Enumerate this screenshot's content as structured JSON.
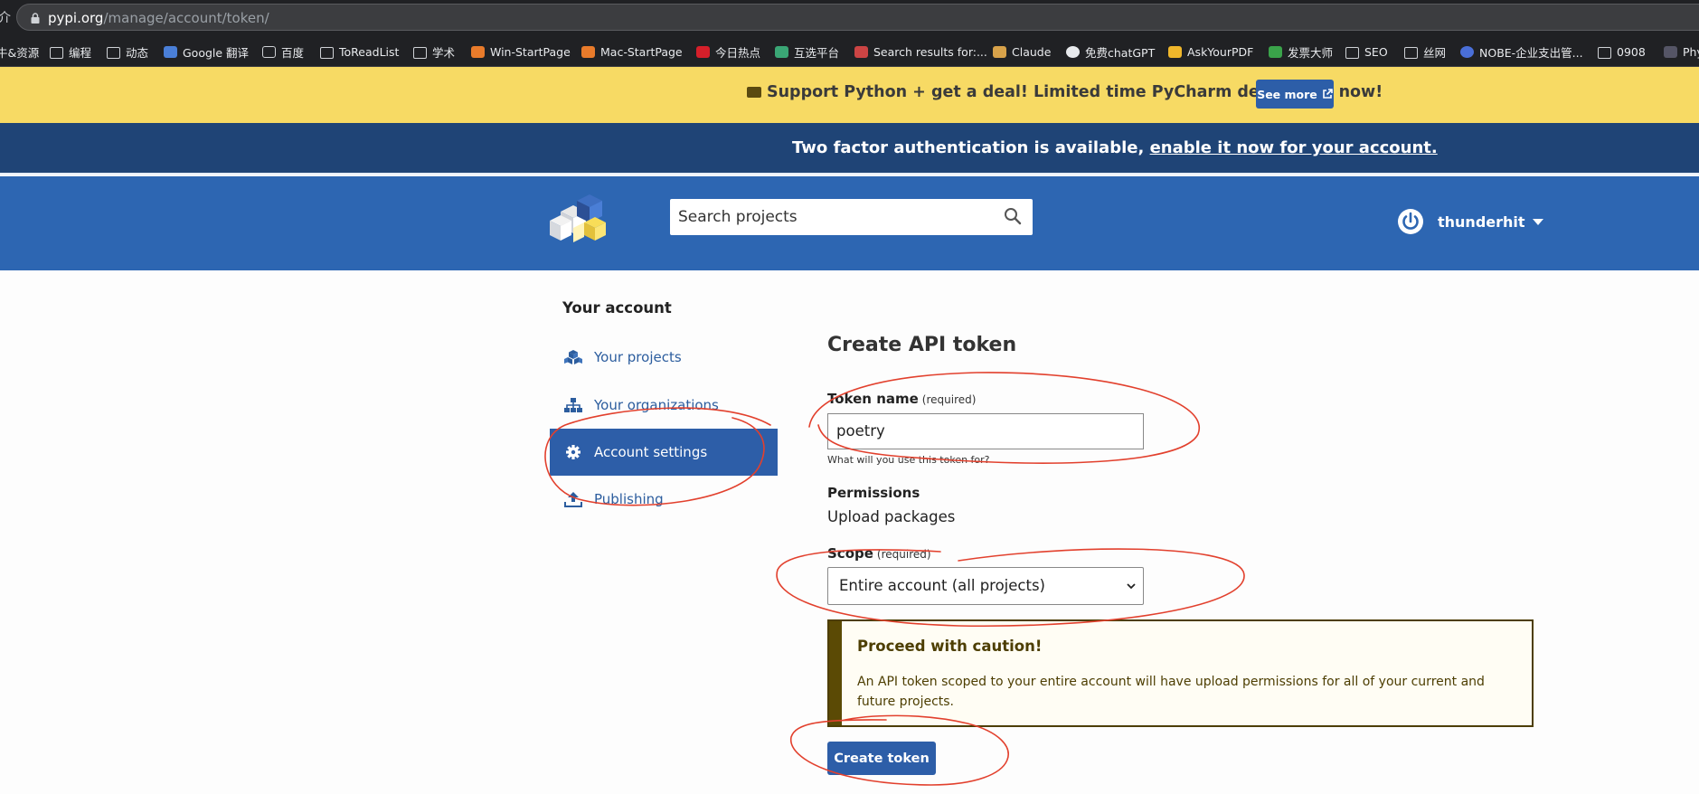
{
  "browser": {
    "url_host": "pypi.org",
    "url_path": "/manage/account/token/",
    "left_glyph": "介",
    "bookmarks": [
      {
        "label": "牛&资源",
        "icon": "text"
      },
      {
        "label": "编程",
        "icon": "folder"
      },
      {
        "label": "动态",
        "icon": "folder"
      },
      {
        "label": "Google 翻译",
        "icon": "translate"
      },
      {
        "label": "百度",
        "icon": "baidu"
      },
      {
        "label": "ToReadList",
        "icon": "folder"
      },
      {
        "label": "学术",
        "icon": "folder"
      },
      {
        "label": "Win-StartPage",
        "icon": "home"
      },
      {
        "label": "Mac-StartPage",
        "icon": "home"
      },
      {
        "label": "今日热点",
        "icon": "r-logo"
      },
      {
        "label": "互选平台",
        "icon": "x-logo"
      },
      {
        "label": "Search results for:...",
        "icon": "site"
      },
      {
        "label": "Claude",
        "icon": "claude"
      },
      {
        "label": "免费chatGPT",
        "icon": "globe"
      },
      {
        "label": "AskYourPDF",
        "icon": "pdf"
      },
      {
        "label": "发票大师",
        "icon": "invoice"
      },
      {
        "label": "SEO",
        "icon": "folder"
      },
      {
        "label": "丝网",
        "icon": "folder"
      },
      {
        "label": "NOBE-企业支出管...",
        "icon": "nobe"
      },
      {
        "label": "0908",
        "icon": "folder"
      },
      {
        "label": "Phy",
        "icon": "site"
      }
    ]
  },
  "promo": {
    "text": "Support Python + get a deal! Limited time PyCharm deal is live now!",
    "button": "See more"
  },
  "twofa": {
    "text": "Two factor authentication is available, ",
    "link": "enable it now for your account."
  },
  "header": {
    "search_placeholder": "Search projects",
    "username": "thunderhit"
  },
  "sidebar": {
    "title": "Your account",
    "items": [
      {
        "label": "Your projects",
        "icon": "cubes-icon",
        "active": false
      },
      {
        "label": "Your organizations",
        "icon": "sitemap-icon",
        "active": false
      },
      {
        "label": "Account settings",
        "icon": "gear-icon",
        "active": true
      },
      {
        "label": "Publishing",
        "icon": "upload-icon",
        "active": false
      }
    ]
  },
  "form": {
    "heading": "Create API token",
    "token_name_label": "Token name",
    "required": "(required)",
    "token_name_value": "poetry",
    "token_help": "What will you use this token for?",
    "permissions_label": "Permissions",
    "permissions_value": "Upload packages",
    "scope_label": "Scope",
    "scope_value": "Entire account (all projects)",
    "caution_title": "Proceed with caution!",
    "caution_body": "An API token scoped to your entire account will have upload permissions for all of your current and future projects.",
    "submit": "Create token"
  },
  "colors": {
    "promo_bg": "#f7da64",
    "twofa_bg": "#1f4476",
    "header_bg": "#2d66b2",
    "primary": "#2d5ea8",
    "annotation": "#e2402d"
  }
}
